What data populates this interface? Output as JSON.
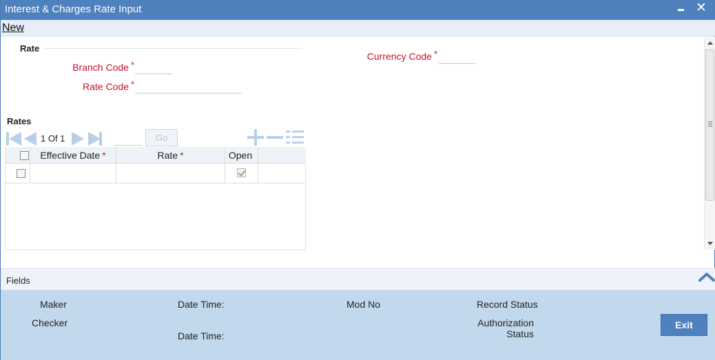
{
  "window": {
    "title": "Interest & Charges Rate Input",
    "minimize_icon": "minimize-icon",
    "close_glyph": "✕"
  },
  "menu": {
    "new_label": "New"
  },
  "rate_section": {
    "title": "Rate",
    "branch_code_label": "Branch Code",
    "branch_code_value": "",
    "rate_code_label": "Rate Code",
    "rate_code_value": "",
    "currency_code_label": "Currency Code",
    "currency_code_value": "",
    "required_mark": "*"
  },
  "rates_grid": {
    "title": "Rates",
    "pagination": {
      "current": "1",
      "of_label": "Of",
      "total": "1",
      "text": "1 Of 1"
    },
    "goto_value": "",
    "go_label": "Go",
    "columns": [
      {
        "label": "Effective Date",
        "required": "*"
      },
      {
        "label": "Rate",
        "required": "*"
      },
      {
        "label": "Open",
        "required": ""
      }
    ],
    "rows": [
      {
        "selected": false,
        "effective_date": "",
        "rate": "",
        "open": true
      }
    ]
  },
  "fields_bar": {
    "label": "Fields"
  },
  "footer": {
    "maker_label": "Maker",
    "checker_label": "Checker",
    "date_time_label": "Date Time:",
    "mod_no_label": "Mod No",
    "record_status_label": "Record Status",
    "authorization_label": "Authorization",
    "status_label": "Status",
    "exit_label": "Exit"
  },
  "colors": {
    "titlebar": "#4e81bd",
    "required_label": "#c8102e",
    "footer_bg": "#c2d8ec",
    "exit_button": "#4e81bd",
    "nav_icons": "#b7cfe8"
  }
}
